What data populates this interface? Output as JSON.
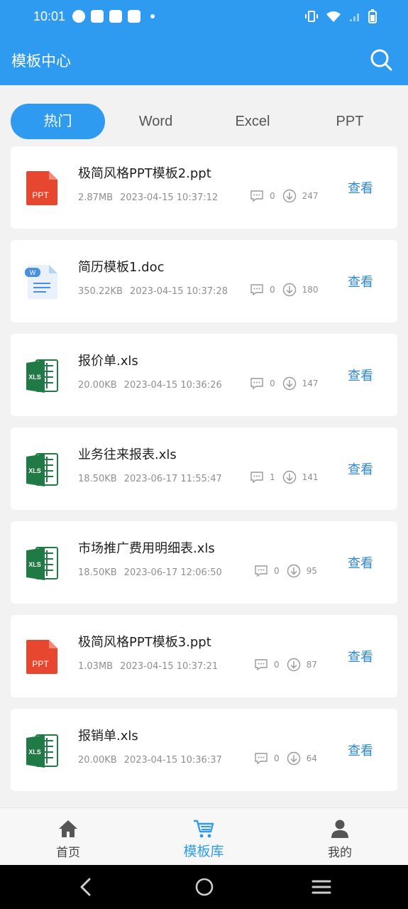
{
  "status_bar": {
    "time": "10:01"
  },
  "app_bar": {
    "title": "模板中心"
  },
  "tabs": [
    {
      "label": "热门",
      "active": true
    },
    {
      "label": "Word",
      "active": false
    },
    {
      "label": "Excel",
      "active": false
    },
    {
      "label": "PPT",
      "active": false
    }
  ],
  "files": [
    {
      "name": "极简风格PPT模板2.ppt",
      "size": "2.87MB",
      "date": "2023-04-15 10:37:12",
      "comments": "0",
      "downloads": "247",
      "type": "ppt",
      "action": "查看"
    },
    {
      "name": "简历模板1.doc",
      "size": "350.22KB",
      "date": "2023-04-15 10:37:28",
      "comments": "0",
      "downloads": "180",
      "type": "doc",
      "action": "查看"
    },
    {
      "name": "报价单.xls",
      "size": "20.00KB",
      "date": "2023-04-15 10:36:26",
      "comments": "0",
      "downloads": "147",
      "type": "xls",
      "action": "查看"
    },
    {
      "name": "业务往来报表.xls",
      "size": "18.50KB",
      "date": "2023-06-17 11:55:47",
      "comments": "1",
      "downloads": "141",
      "type": "xls",
      "action": "查看"
    },
    {
      "name": "市场推广费用明细表.xls",
      "size": "18.50KB",
      "date": "2023-06-17 12:06:50",
      "comments": "0",
      "downloads": "95",
      "type": "xls",
      "action": "查看"
    },
    {
      "name": "极简风格PPT模板3.ppt",
      "size": "1.03MB",
      "date": "2023-04-15 10:37:21",
      "comments": "0",
      "downloads": "87",
      "type": "ppt",
      "action": "查看"
    },
    {
      "name": "报销单.xls",
      "size": "20.00KB",
      "date": "2023-04-15 10:36:37",
      "comments": "0",
      "downloads": "64",
      "type": "xls",
      "action": "查看"
    }
  ],
  "icon_labels": {
    "ppt": "PPT",
    "doc": "W",
    "xls": "XLS"
  },
  "bottom_nav": [
    {
      "label": "首页",
      "icon": "home-icon",
      "active": false
    },
    {
      "label": "模板库",
      "icon": "cart-icon",
      "active": true
    },
    {
      "label": "我的",
      "icon": "user-icon",
      "active": false
    }
  ],
  "colors": {
    "primary": "#2e9bf0",
    "ppt": "#e8472f",
    "xls": "#1f7a45",
    "doc": "#4a8fe0",
    "link": "#2e87d8"
  }
}
